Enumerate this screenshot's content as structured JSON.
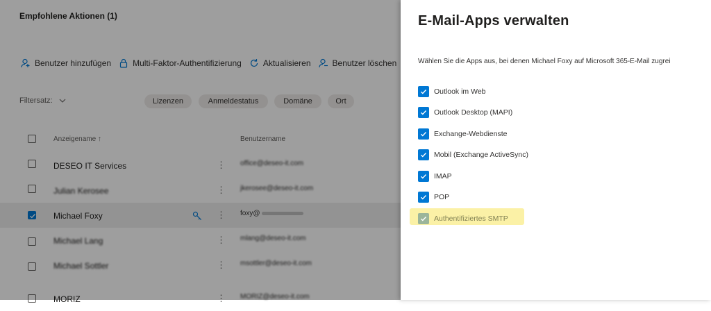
{
  "section_title": "Empfohlene Aktionen (1)",
  "toolbar": {
    "add_user": "Benutzer hinzufügen",
    "mfa": "Multi-Faktor-Authentifizierung",
    "refresh": "Aktualisieren",
    "delete_user": "Benutzer löschen"
  },
  "filters": {
    "label": "Filtersatz:",
    "pills": [
      "Lizenzen",
      "Anmeldestatus",
      "Domäne",
      "Ort"
    ]
  },
  "grid": {
    "col_display_name": "Anzeigename ↑",
    "col_username": "Benutzername",
    "rows": [
      {
        "name": "DESEO IT Services",
        "username": "office@deseo-it.com",
        "selected": false
      },
      {
        "name": "Julian Kerosee",
        "username": "jkerosee@deseo-it.com",
        "selected": false
      },
      {
        "name": "Michael Foxy",
        "username": "foxy@",
        "selected": true
      },
      {
        "name": "Michael Lang",
        "username": "mlang@deseo-it.com",
        "selected": false
      },
      {
        "name": "Michael Sottler",
        "username": "msottler@deseo-it.com",
        "selected": false
      },
      {
        "name": "MORIZ",
        "username": "MORIZ@deseo-it.com",
        "selected": false
      }
    ]
  },
  "panel": {
    "title": "E-Mail-Apps verwalten",
    "description": "Wählen Sie die Apps aus, bei denen Michael Foxy auf Microsoft 365-E-Mail zugrei",
    "apps": [
      {
        "label": "Outlook im Web",
        "checked": true
      },
      {
        "label": "Outlook Desktop (MAPI)",
        "checked": true
      },
      {
        "label": "Exchange-Webdienste",
        "checked": true
      },
      {
        "label": "Mobil (Exchange ActiveSync)",
        "checked": true
      },
      {
        "label": "IMAP",
        "checked": true
      },
      {
        "label": "POP",
        "checked": true
      },
      {
        "label": "Authentifiziertes SMTP",
        "checked": true
      }
    ]
  },
  "colors": {
    "accent": "#0078d4",
    "highlight": "#fbf1a6"
  }
}
